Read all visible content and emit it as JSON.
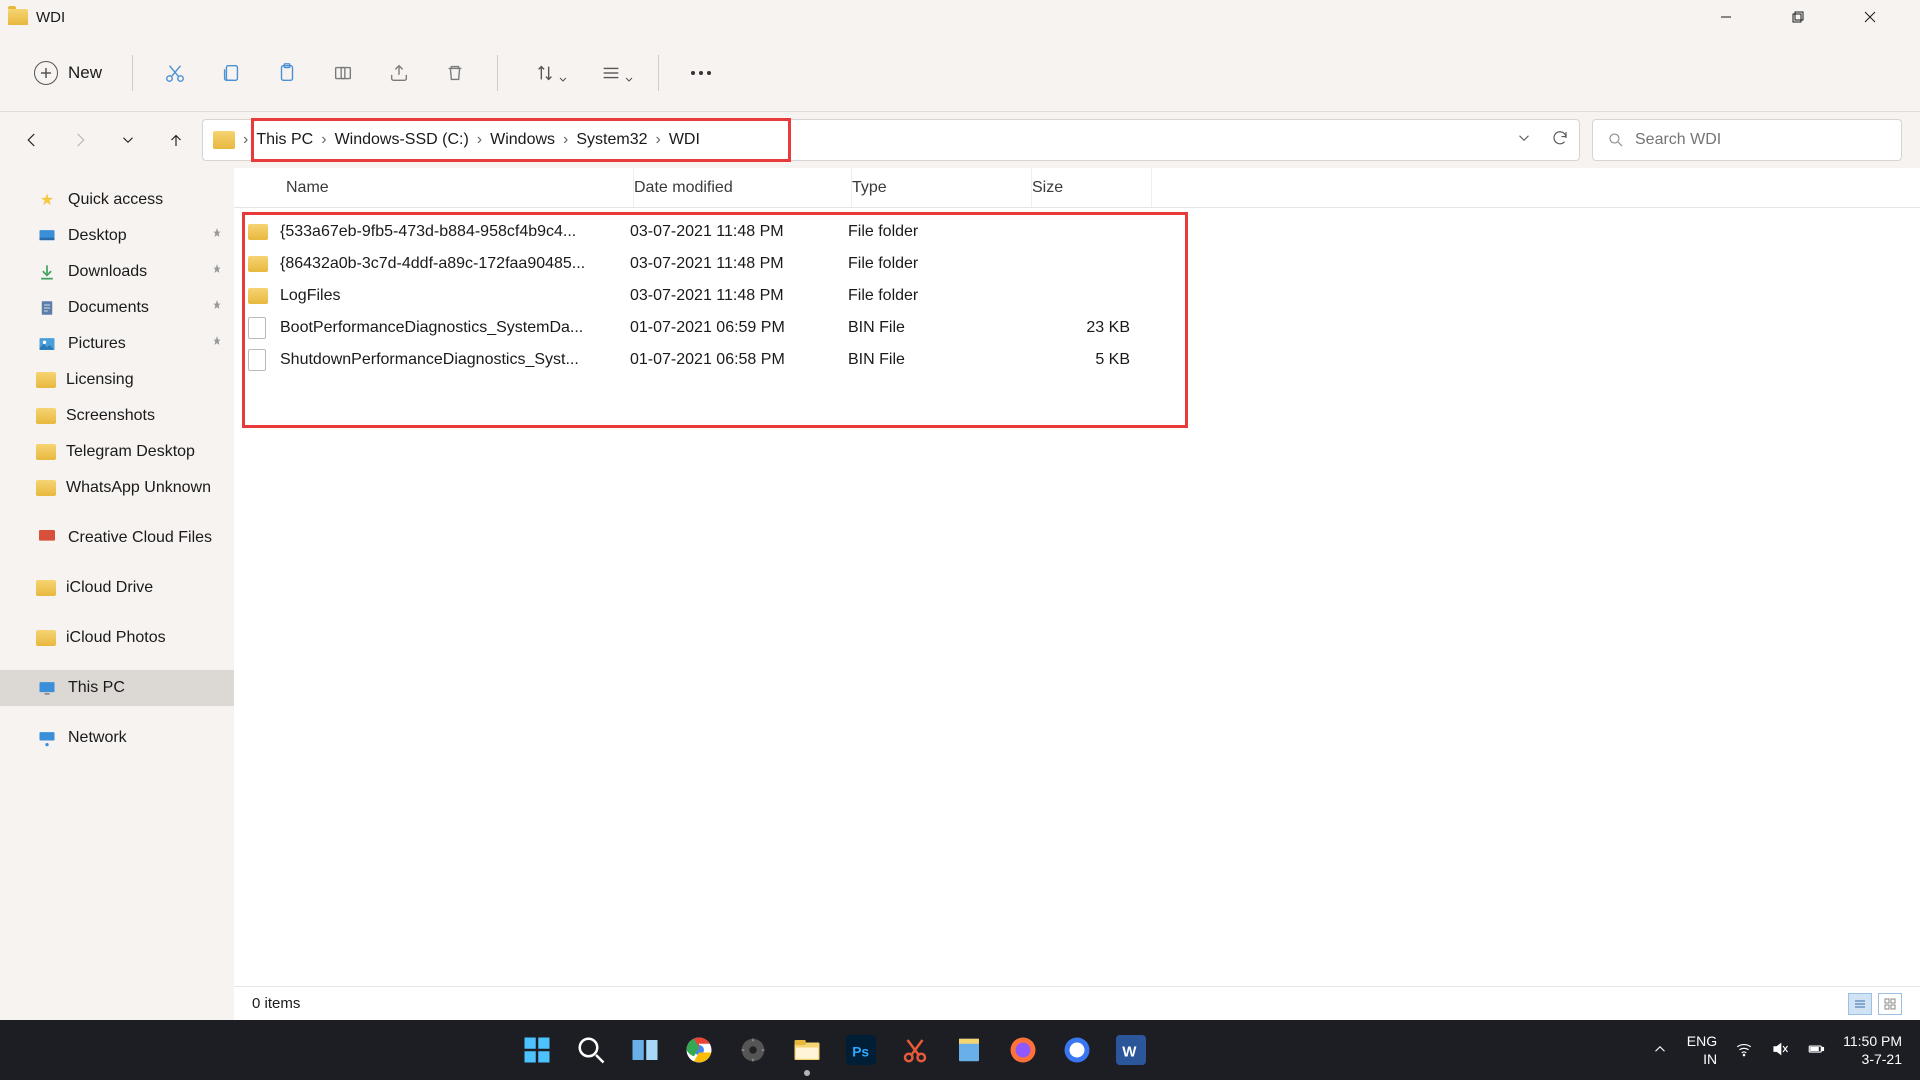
{
  "window": {
    "title": "WDI"
  },
  "toolbar": {
    "new_label": "New",
    "icons": {
      "cut": "cut-icon",
      "copy": "copy-icon",
      "paste": "paste-icon",
      "rename": "rename-icon",
      "share": "share-icon",
      "delete": "delete-icon",
      "sort": "sort-icon",
      "view": "view-icon",
      "more": "more-icon"
    }
  },
  "breadcrumb": {
    "items": [
      "This PC",
      "Windows-SSD (C:)",
      "Windows",
      "System32",
      "WDI"
    ]
  },
  "search": {
    "placeholder": "Search WDI"
  },
  "sidebar": {
    "quick_access": "Quick access",
    "pinned": [
      {
        "label": "Desktop",
        "icon": "desktop"
      },
      {
        "label": "Downloads",
        "icon": "download"
      },
      {
        "label": "Documents",
        "icon": "doc"
      },
      {
        "label": "Pictures",
        "icon": "pic"
      }
    ],
    "folders": [
      {
        "label": "Licensing"
      },
      {
        "label": "Screenshots"
      },
      {
        "label": "Telegram Desktop"
      },
      {
        "label": "WhatsApp Unknown"
      }
    ],
    "cloud": [
      {
        "label": "Creative Cloud Files",
        "icon": "cc"
      },
      {
        "label": "iCloud Drive",
        "icon": "icloud"
      },
      {
        "label": "iCloud Photos",
        "icon": "icloud"
      }
    ],
    "thispc": "This PC",
    "network": "Network"
  },
  "columns": {
    "name": "Name",
    "date": "Date modified",
    "type": "Type",
    "size": "Size"
  },
  "files": [
    {
      "name": "{533a67eb-9fb5-473d-b884-958cf4b9c4...",
      "date": "03-07-2021 11:48 PM",
      "type": "File folder",
      "size": "",
      "icon": "folder"
    },
    {
      "name": "{86432a0b-3c7d-4ddf-a89c-172faa90485...",
      "date": "03-07-2021 11:48 PM",
      "type": "File folder",
      "size": "",
      "icon": "folder"
    },
    {
      "name": "LogFiles",
      "date": "03-07-2021 11:48 PM",
      "type": "File folder",
      "size": "",
      "icon": "folder"
    },
    {
      "name": "BootPerformanceDiagnostics_SystemDa...",
      "date": "01-07-2021 06:59 PM",
      "type": "BIN File",
      "size": "23 KB",
      "icon": "file"
    },
    {
      "name": "ShutdownPerformanceDiagnostics_Syst...",
      "date": "01-07-2021 06:58 PM",
      "type": "BIN File",
      "size": "5 KB",
      "icon": "file"
    }
  ],
  "statusbar": {
    "text": "0 items"
  },
  "taskbar": {
    "lang1": "ENG",
    "lang2": "IN",
    "time": "11:50 PM",
    "date": "3-7-21"
  }
}
